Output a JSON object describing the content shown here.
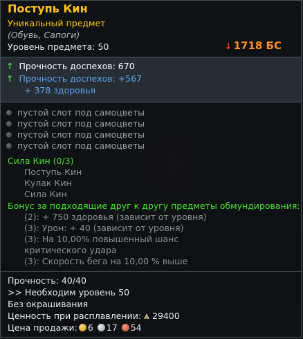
{
  "item": {
    "name": "Поступь Кин",
    "rarity": "Уникальный предмет",
    "type": "(Обувь, Сапоги)",
    "level": "Уровень предмета: 50",
    "price": "1718 БС"
  },
  "stats": {
    "line1": "Прочность доспехов: 670",
    "line2": "Прочность доспехов: +567",
    "line3": "+ 378 здоровья"
  },
  "sockets": [
    "пустой слот под самоцветы",
    "пустой слот под самоцветы",
    "пустой слот под самоцветы",
    "пустой слот под самоцветы"
  ],
  "set": {
    "title": "Сила Кин (0/3)",
    "items": [
      "Поступь Кин",
      "Кулак Кин",
      "Сила Кин"
    ]
  },
  "bonus": {
    "title": "Бонус за подходящие друг к другу предметы обмундирования:",
    "lines": [
      "(2): + 750 здоровья (зависит от уровня)",
      "(3): Урон: + 40 (зависит от уровня)",
      "(3): На 10,00% повышенный шанс",
      "критического удара",
      "(3): Скорость бега на 10,00 % выше"
    ]
  },
  "footer": {
    "durability": "Прочность: 40/40",
    "required": ">> Необходим уровень 50",
    "dye": "Без окрашивания",
    "smelt_label": "Ценность при расплавлении:",
    "smelt_value": "29400",
    "sell_label": "Цена продажи:",
    "sell_gold": "6",
    "sell_silver": "17",
    "sell_copper": "54"
  },
  "icons": [
    "arrow-up-icon",
    "price-down-arrow-icon",
    "socket-icon",
    "dust-icon",
    "gold-coin-icon",
    "silver-coin-icon",
    "copper-coin-icon"
  ]
}
